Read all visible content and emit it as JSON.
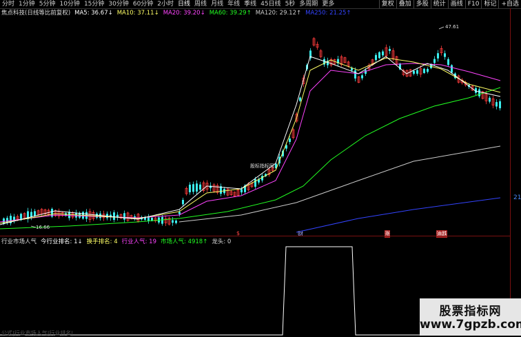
{
  "toolbar": {
    "timeframes": [
      "分时",
      "1分钟",
      "5分钟",
      "10分钟",
      "15分钟",
      "30分钟",
      "60分钟",
      "2小时",
      "日线",
      "周线",
      "月线",
      "年线",
      "季线",
      "45日线",
      "5秒",
      "多周期",
      "更多"
    ],
    "active_index": 8,
    "right_buttons": [
      "复权",
      "叠加",
      "多股",
      "统计",
      "画线",
      "F10",
      "标记",
      "+自选"
    ]
  },
  "legend": {
    "stock": "焦点科技(日线等比前复权)",
    "ma5": "MA5: 36.67↓",
    "ma10": "MA10: 37.11↓",
    "ma20": "MA20: 39.20↓",
    "ma60": "MA60: 39.29↑",
    "ma120": "MA120: 29.12↑",
    "ma250": "MA250: 21.25↑"
  },
  "colors": {
    "ma5": "#ffffff",
    "ma10": "#ffff66",
    "ma20": "#ff44ff",
    "ma60": "#22ff22",
    "ma120": "#cccccc",
    "ma250": "#3344ff",
    "up": "#ff3c3c",
    "down": "#3cf0f0",
    "divider": "#7a1010"
  },
  "chart": {
    "low_label": "16.66",
    "high_label": "47.61",
    "stamp": "股标指标网",
    "right_value": "21",
    "events": [
      "$",
      "财",
      "涨",
      "油跌"
    ]
  },
  "indicator": {
    "label1": "行业市场人气",
    "label2": "今行业排名: 1↓",
    "label3": "换手排名: 4",
    "label4": "行业人气: 19",
    "label5": "市场人气: 4918↑",
    "label6": "龙头: 0"
  },
  "watermark": {
    "line1": "股票指标网",
    "line2": "www.7gpzb.com"
  },
  "bottom": "公式|行业市场人气|行业排名|"
}
